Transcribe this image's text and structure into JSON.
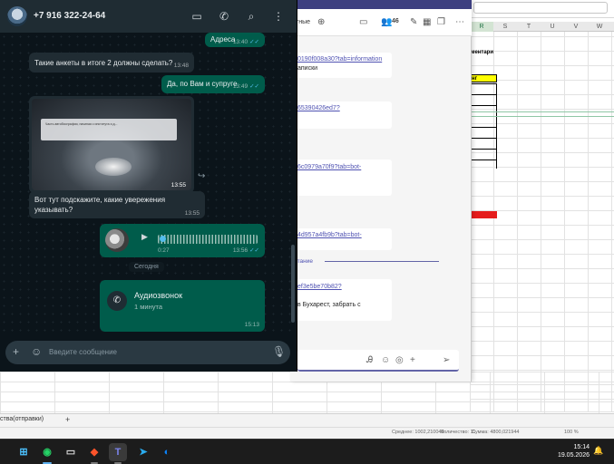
{
  "excel": {
    "columns": [
      "R",
      "S",
      "T",
      "U",
      "V",
      "W"
    ],
    "header_cell": "ментари",
    "yellow_cell": "нг",
    "sheet_tab": "ства(отправки)",
    "status_items": [
      "Среднее: 1002,210049",
      "Количество: 11",
      "Сумма: 4800,021944",
      "100 %"
    ]
  },
  "teams": {
    "header_label": "тные",
    "participants_count": "46",
    "messages": [
      {
        "link": "0190f008a30?tab=information",
        "text": "аписки"
      },
      {
        "link": "65390426ed7?",
        "text": ""
      },
      {
        "link": "6c0979a70f9?tab=bot-",
        "text": ""
      },
      {
        "link": "4d957a4fb9b?tab=bot-",
        "text": ""
      },
      {
        "link": "ef3e5be70b82?",
        "text": "в Бухарест, забрать с"
      }
    ],
    "separator_label": "итание"
  },
  "whatsapp": {
    "contact": "+7 916 322-24-64",
    "messages": {
      "m1": {
        "text": "Адреса",
        "time": "13:40"
      },
      "m2": {
        "text": "Такие анкеты в итоге 2 должны сделать?",
        "time": "13:48"
      },
      "m3": {
        "text": "Да, по Вам и супруге",
        "time": "13:49"
      },
      "m4": {
        "image_caption": "Часть автобиографии, начиная с института и д...",
        "image_time": "13:55"
      },
      "m5": {
        "line1": "Вот тут подскажите, какие увережения",
        "line2": "указывать?",
        "time": "13:55"
      },
      "m6": {
        "duration": "0:27",
        "time": "13:56"
      },
      "date_chip": "Сегодня",
      "m7": {
        "title": "Аудиозвонок",
        "subtitle": "1 минута",
        "time": "15:13"
      }
    },
    "composer_placeholder": "Введите сообщение"
  },
  "taskbar": {
    "time": "15:14",
    "date": "19.05.2026"
  }
}
